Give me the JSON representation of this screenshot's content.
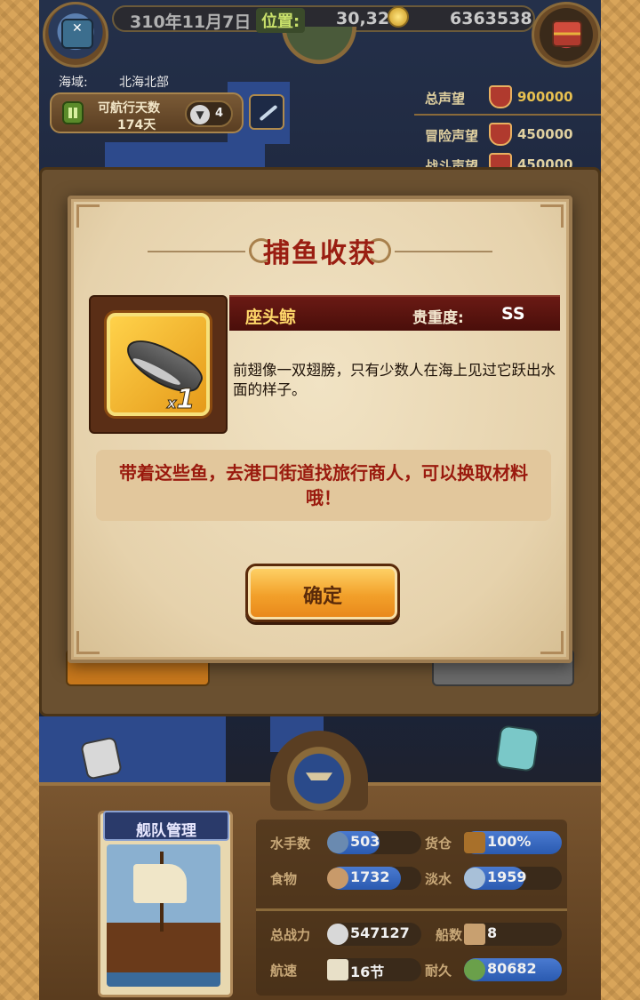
{
  "hud": {
    "date": "310年11月7日",
    "position_label": "位置:",
    "position_value": "30,32",
    "gold": "6363538"
  },
  "sea": {
    "label": "海域:",
    "value": "北海北部"
  },
  "sailing": {
    "label": "可航行天数",
    "days": "174天",
    "count": "4"
  },
  "fame": {
    "total_label": "总声望",
    "total_value": "900000",
    "adventure_label": "冒险声望",
    "adventure_value": "450000",
    "battle_label": "战斗声望",
    "battle_value": "450000"
  },
  "modal": {
    "title": "捕鱼收获",
    "item_name": "座头鲸",
    "rarity_label": "贵重度:",
    "rarity_value": "SS",
    "quantity_prefix": "x",
    "quantity": "1",
    "description": "前翅像一双翅膀，只有少数人在海上见过它跃出水面的样子。",
    "hint": "带着这些鱼，去港口街道找旅行商人，可以换取材料哦！",
    "confirm_label": "确定"
  },
  "fleet": {
    "title": "舰队管理",
    "stats": {
      "sailors_label": "水手数",
      "sailors_value": "503",
      "cargo_label": "货仓",
      "cargo_value": "100%",
      "food_label": "食物",
      "food_value": "1732",
      "water_label": "淡水",
      "water_value": "1959",
      "power_label": "总战力",
      "power_value": "547127",
      "ships_label": "船数",
      "ships_value": "8",
      "speed_label": "航速",
      "speed_value": "16节",
      "durability_label": "耐久",
      "durability_value": "80682"
    }
  },
  "colors": {
    "title_red": "#9a1e12",
    "item_name_yellow": "#ffd86a",
    "button_orange": "#f2a02a",
    "stat_bar_blue": "#2a5ab0"
  },
  "icons": {
    "avatar": "pirate-avatar-icon",
    "treasure": "treasure-chest-icon",
    "coin": "coin-icon",
    "item": "humpback-whale-icon"
  }
}
